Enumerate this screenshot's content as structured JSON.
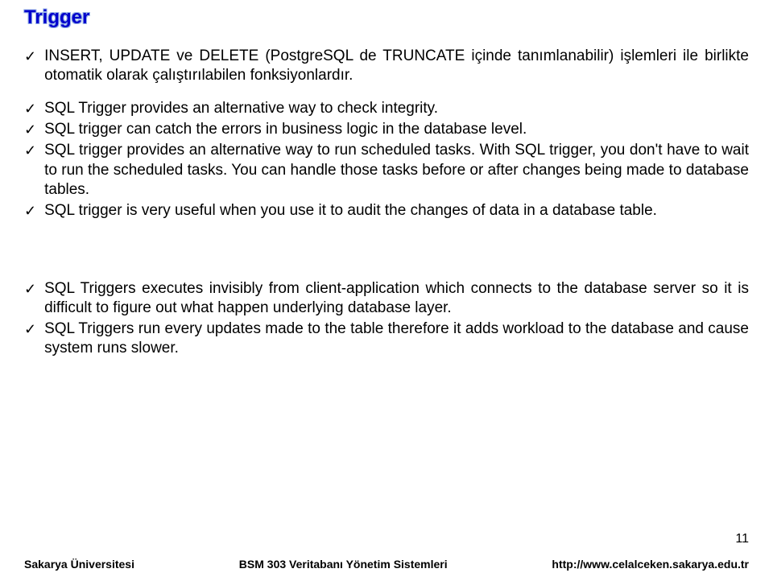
{
  "title": "Trigger",
  "bullets": {
    "group1": [
      "INSERT, UPDATE  ve DELETE (PostgreSQL de TRUNCATE içinde tanımlanabilir) işlemleri ile birlikte otomatik olarak çalıştırılabilen fonksiyonlardır."
    ],
    "group2": [
      "SQL Trigger provides an alternative way to check integrity.",
      "SQL trigger can catch the errors in business logic in the database level.",
      "SQL trigger provides an alternative way to run scheduled tasks. With SQL trigger, you don't have to wait to run the scheduled tasks. You can handle those tasks before or after changes being made to database tables.",
      "SQL trigger is very useful when you use it to audit the changes of data in a database table."
    ],
    "group3": [
      "SQL Triggers executes invisibly from client-application which connects to the database server so it is difficult to figure out what happen underlying database layer.",
      "SQL Triggers run every updates made to the table therefore it adds workload to the database and cause system runs slower."
    ]
  },
  "pageNumber": "11",
  "footer": {
    "left": "Sakarya Üniversitesi",
    "center": "BSM 303 Veritabanı Yönetim Sistemleri",
    "right": "http://www.celalceken.sakarya.edu.tr"
  }
}
